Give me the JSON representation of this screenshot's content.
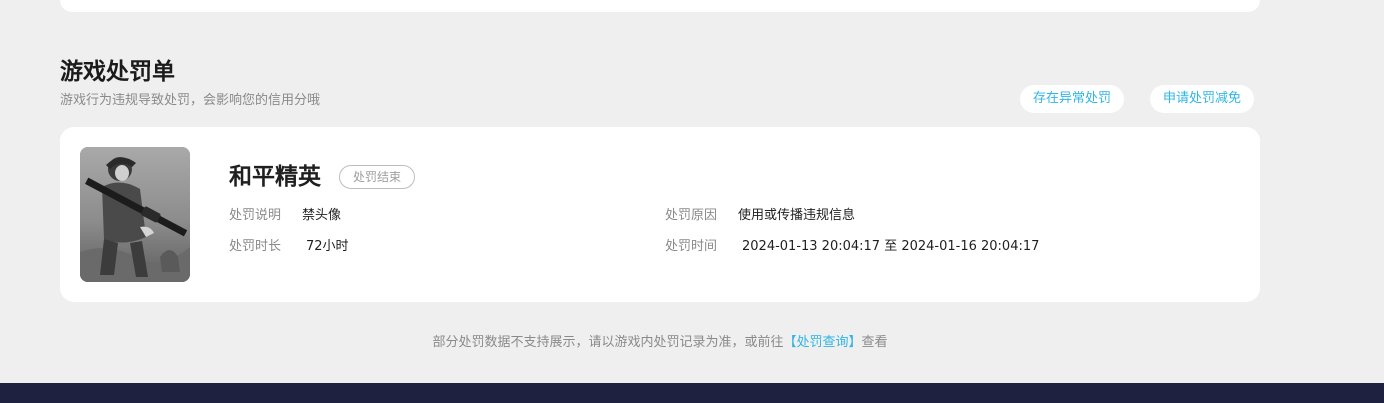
{
  "section": {
    "title": "游戏处罚单",
    "subtitle": "游戏行为违规导致处罚，会影响您的信用分哦"
  },
  "actions": {
    "appeal_label": "存在异常处罚",
    "reduce_label": "申请处罚减免"
  },
  "penalty": {
    "game_name": "和平精英",
    "status": "处罚结束",
    "description_label": "处罚说明",
    "description_value": "禁头像",
    "reason_label": "处罚原因",
    "reason_value": "使用或传播违规信息",
    "duration_label": "处罚时长",
    "duration_value": "72小时",
    "time_label": "处罚时间",
    "time_value": "2024-01-13 20:04:17 至 2024-01-16 20:04:17"
  },
  "footer": {
    "note_prefix": "部分处罚数据不支持展示，请以游戏内处罚记录为准，或前往",
    "link_label": "【处罚查询】",
    "note_suffix": "查看"
  },
  "colors": {
    "accent": "#2fb6e3",
    "background": "#efefef",
    "footer_bar": "#1f2140"
  }
}
